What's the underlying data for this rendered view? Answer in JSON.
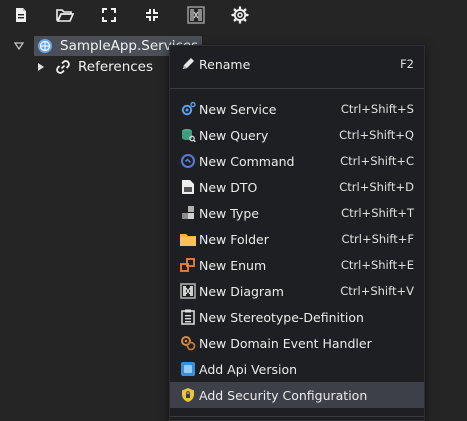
{
  "toolbar": {
    "buttons": [
      {
        "icon": "new-file-icon"
      },
      {
        "icon": "open-folder-icon"
      },
      {
        "icon": "expand-all-icon"
      },
      {
        "icon": "collapse-all-icon"
      },
      {
        "icon": "diagram-icon"
      },
      {
        "icon": "gear-icon"
      }
    ]
  },
  "tree": {
    "root": {
      "label": "SampleApp.Services",
      "icon": "globe-icon",
      "expanded": true,
      "selected": true
    },
    "children": [
      {
        "label": "References",
        "icon": "link-icon",
        "expanded": false
      }
    ]
  },
  "context_menu": {
    "items": [
      {
        "label": "Rename",
        "shortcut": "F2",
        "icon": "pencil-icon"
      },
      {
        "label": "New Service",
        "shortcut": "Ctrl+Shift+S",
        "icon": "service-icon"
      },
      {
        "label": "New Query",
        "shortcut": "Ctrl+Shift+Q",
        "icon": "query-icon"
      },
      {
        "label": "New Command",
        "shortcut": "Ctrl+Shift+C",
        "icon": "command-icon"
      },
      {
        "label": "New DTO",
        "shortcut": "Ctrl+Shift+D",
        "icon": "dto-icon"
      },
      {
        "label": "New Type",
        "shortcut": "Ctrl+Shift+T",
        "icon": "type-icon"
      },
      {
        "label": "New Folder",
        "shortcut": "Ctrl+Shift+F",
        "icon": "folder-icon"
      },
      {
        "label": "New Enum",
        "shortcut": "Ctrl+Shift+E",
        "icon": "enum-icon"
      },
      {
        "label": "New Diagram",
        "shortcut": "Ctrl+Shift+V",
        "icon": "diagram-icon"
      },
      {
        "label": "New Stereotype-Definition",
        "shortcut": "",
        "icon": "stereotype-icon"
      },
      {
        "label": "New Domain Event Handler",
        "shortcut": "",
        "icon": "event-handler-icon"
      },
      {
        "label": "Add Api Version",
        "shortcut": "",
        "icon": "api-version-icon"
      },
      {
        "label": "Add Security Configuration",
        "shortcut": "",
        "icon": "security-shield-icon",
        "highlighted": true
      }
    ]
  },
  "colors": {
    "background": "#252526",
    "menu_background": "#1e1f22",
    "highlight": "#3d4049",
    "selection": "#4b4f57",
    "folder": "#f4b23a",
    "shield": "#e8c640"
  }
}
